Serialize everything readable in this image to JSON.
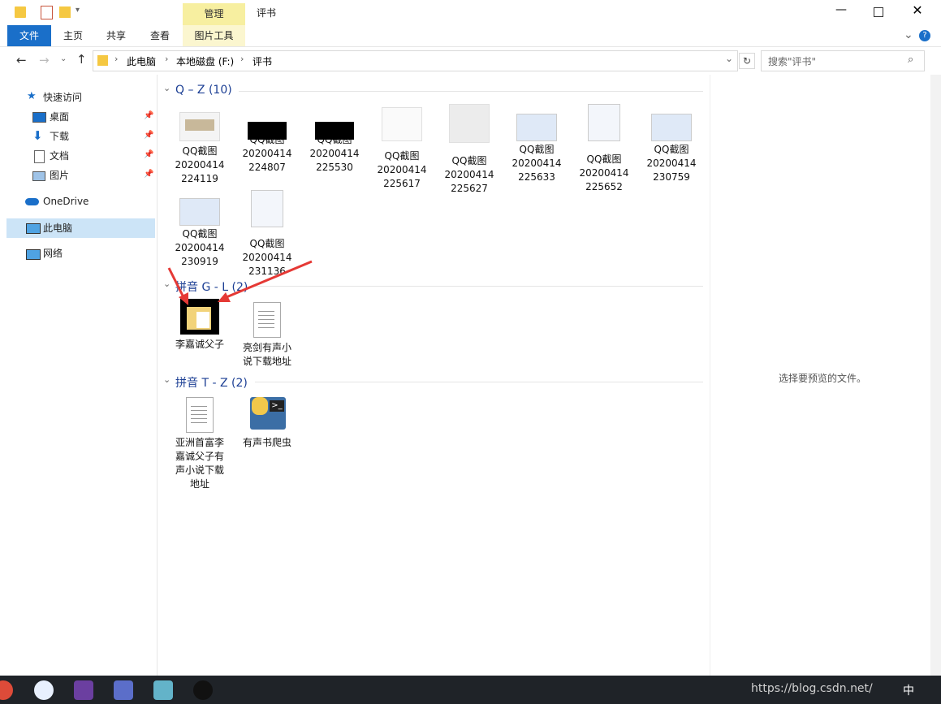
{
  "window": {
    "title": "评书",
    "context_tab": "管理",
    "context_group": "图片工具"
  },
  "ribbon": {
    "tabs": [
      "文件",
      "主页",
      "共享",
      "查看"
    ]
  },
  "address": {
    "path": [
      "此电脑",
      "本地磁盘 (F:)",
      "评书"
    ],
    "search_placeholder": "搜索\"评书\""
  },
  "nav": {
    "quick_access": "快速访问",
    "pinned": [
      "桌面",
      "下载",
      "文档",
      "图片"
    ],
    "onedrive": "OneDrive",
    "this_pc": "此电脑",
    "network": "网络"
  },
  "groups": [
    {
      "title": "Q – Z (10)",
      "items": [
        {
          "l1": "QQ截图",
          "l2": "20200414",
          "l3": "224119"
        },
        {
          "l1": "QQ截图",
          "l2": "20200414",
          "l3": "224807"
        },
        {
          "l1": "QQ截图",
          "l2": "20200414",
          "l3": "225530"
        },
        {
          "l1": "QQ截图",
          "l2": "20200414",
          "l3": "225617"
        },
        {
          "l1": "QQ截图",
          "l2": "20200414",
          "l3": "225627"
        },
        {
          "l1": "QQ截图",
          "l2": "20200414",
          "l3": "225633"
        },
        {
          "l1": "QQ截图",
          "l2": "20200414",
          "l3": "225652"
        },
        {
          "l1": "QQ截图",
          "l2": "20200414",
          "l3": "230759"
        },
        {
          "l1": "QQ截图",
          "l2": "20200414",
          "l3": "230919"
        },
        {
          "l1": "QQ截图",
          "l2": "20200414",
          "l3": "231136"
        }
      ]
    },
    {
      "title": "拼音 G - L (2)",
      "items": [
        {
          "l1": "李嘉诚父子",
          "l2": "",
          "l3": ""
        },
        {
          "l1": "亮剑有声小",
          "l2": "说下载地址",
          "l3": ""
        }
      ]
    },
    {
      "title": "拼音 T - Z (2)",
      "items": [
        {
          "l1": "亚洲首富李",
          "l2": "嘉诚父子有",
          "l3": "声小说下载",
          "l4": "地址"
        },
        {
          "l1": "有声书爬虫",
          "l2": "",
          "l3": ""
        }
      ]
    }
  ],
  "preview": {
    "message": "选择要预览的文件。"
  },
  "taskbar": {
    "watermark": "https://blog.csdn.net/",
    "tray": "中"
  },
  "colors": {
    "accent": "#1a6fc9",
    "group_title": "#1c3f94",
    "manage_tab": "#f7efa0",
    "arrow": "#e53935"
  }
}
